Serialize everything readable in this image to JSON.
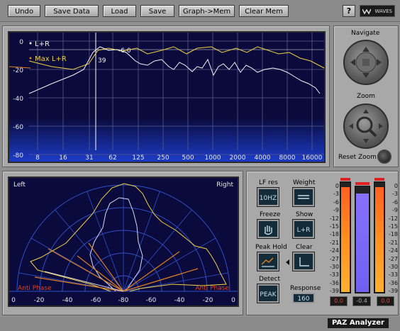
{
  "toolbar": {
    "undo": "Undo",
    "save_data": "Save Data",
    "load": "Load",
    "save": "Save",
    "graph_mem": "Graph->Mem",
    "clear_mem": "Clear Mem",
    "help": "?",
    "logo": "WAVES"
  },
  "spectrum": {
    "y_ticks": [
      "0",
      "-20",
      "-40",
      "-60",
      "-80"
    ],
    "x_ticks": [
      "8",
      "16",
      "31",
      "62",
      "125",
      "250",
      "500",
      "1000",
      "2000",
      "4000",
      "8000",
      "16000"
    ],
    "legend": [
      "L+R",
      "Max L+R"
    ],
    "cursor_freq": "39",
    "cursor_level": "-6.0"
  },
  "stereo": {
    "left": "Left",
    "right": "Right",
    "anti_left": "Anti Phase",
    "anti_right": "Anti Phase",
    "x_ticks": [
      "0",
      "-20",
      "-40",
      "-60",
      "-80",
      "-60",
      "-40",
      "-20",
      "0"
    ]
  },
  "navigate": {
    "title": "Navigate",
    "zoom": "Zoom",
    "reset_zoom": "Reset Zoom"
  },
  "controls": {
    "lf_res": "LF res",
    "lf_res_value": "10HZ",
    "weight": "Weight",
    "freeze": "Freeze",
    "show": "Show",
    "show_value": "L+R",
    "peak_hold": "Peak Hold",
    "clear": "Clear",
    "detect": "Detect",
    "detect_value": "PEAK",
    "response": "Response",
    "response_value": "160"
  },
  "meters": {
    "scale": [
      "0",
      "-3",
      "-6",
      "-9",
      "-12",
      "-15",
      "-18",
      "-21",
      "-24",
      "-27",
      "-30",
      "-33",
      "-36",
      "-39"
    ],
    "left_value": "0.0",
    "center_value": "-0.4",
    "right_value": "0.0",
    "left_level": 0.95,
    "center_level": 0.93,
    "right_level": 0.95
  },
  "footer": {
    "title": "PAZ Analyzer"
  },
  "colors": {
    "screen_bg": "#0a0a3c",
    "curve_white": "#f4f4f4",
    "curve_yellow": "#f0d040",
    "accent_orange": "#e08020"
  }
}
